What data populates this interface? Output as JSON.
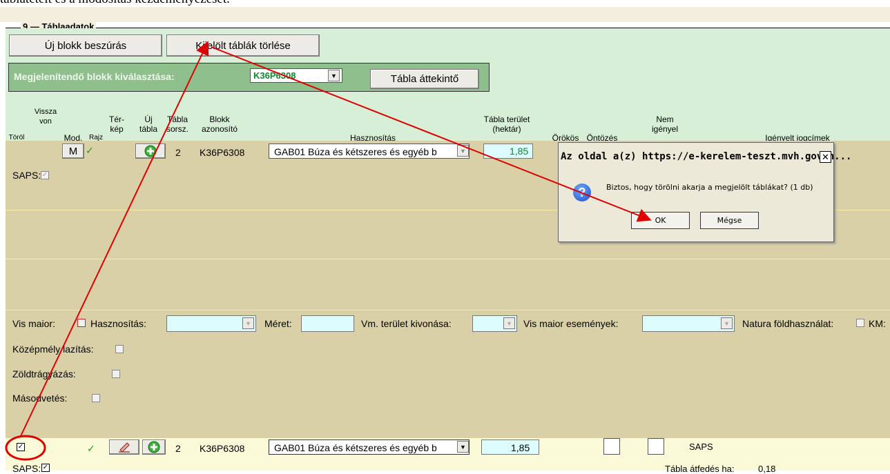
{
  "top_cut_text": "táblatételt és a módosítás kezdeményezését.",
  "section": {
    "number": "9",
    "title": "Táblaadatok"
  },
  "toolbar": {
    "new_block": "Új blokk beszúrás",
    "delete_selected": "Kijelölt táblák törlése"
  },
  "block_select": {
    "label": "Megjelenítendő blokk kiválasztása:",
    "value": "K36P6308",
    "overview_button": "Tábla áttekintő"
  },
  "headers": {
    "torol": "Töröl",
    "visszavon": "Vissza von",
    "mod": "Mod.",
    "rajz": "Rajz",
    "terkep": "Tér- kép",
    "uj_tabla": "Új tábla",
    "tabla_sorsz": "Tábla sorsz.",
    "blokk_azonosito": "Blokk azonosító",
    "hasznositas": "Hasznosítás",
    "tabla_terulet": "Tábla terület (hektár)",
    "orokos": "Örökös",
    "ontozes": "Öntözés",
    "nem_igenyel": "Nem igényel",
    "igenyelt_jogcimek": "Igényelt jogcímek"
  },
  "row1": {
    "mod_button": "M",
    "check": "✓",
    "table_no": "2",
    "block_id": "K36P6308",
    "usage": "GAB01 Búza és kétszeres és egyéb b",
    "area": "1,85",
    "saps_label": "SAPS:",
    "saps_checked": true
  },
  "vis_maior": {
    "label": "Vis maior:",
    "hasznositas_label": "Hasznosítás:",
    "meret_label": "Méret:",
    "vm_label": "Vm. terület kivonása:",
    "esemenyek_label": "Vis maior események:",
    "natura_label": "Natura földhasználat:",
    "km_label": "KM:"
  },
  "extras": {
    "kozepmely": "Középmély lazítás:",
    "zoldtragyazas": "Zöldtrágyázás:",
    "masodvetes": "Másodvetés:"
  },
  "row2": {
    "checked": true,
    "check": "✓",
    "table_no": "2",
    "block_id": "K36P6308",
    "usage": "GAB01 Búza és kétszeres és egyéb b",
    "area": "1,85",
    "claim": "SAPS",
    "saps_label": "SAPS:",
    "saps_checked": true,
    "overlap_label": "Tábla átfedés ha:",
    "overlap_value": "0,18"
  },
  "dialog": {
    "title": "Az oldal a(z) https://e-kerelem-teszt.mvh.gov.h...",
    "message": "Biztos, hogy törölni akarja a megjelölt táblákat? (1 db)",
    "ok": "OK",
    "cancel": "Mégse"
  },
  "colors": {
    "annotation_red": "#e00000",
    "green_panel": "#d7efd6",
    "khaki_panel": "#d9d0a8"
  }
}
